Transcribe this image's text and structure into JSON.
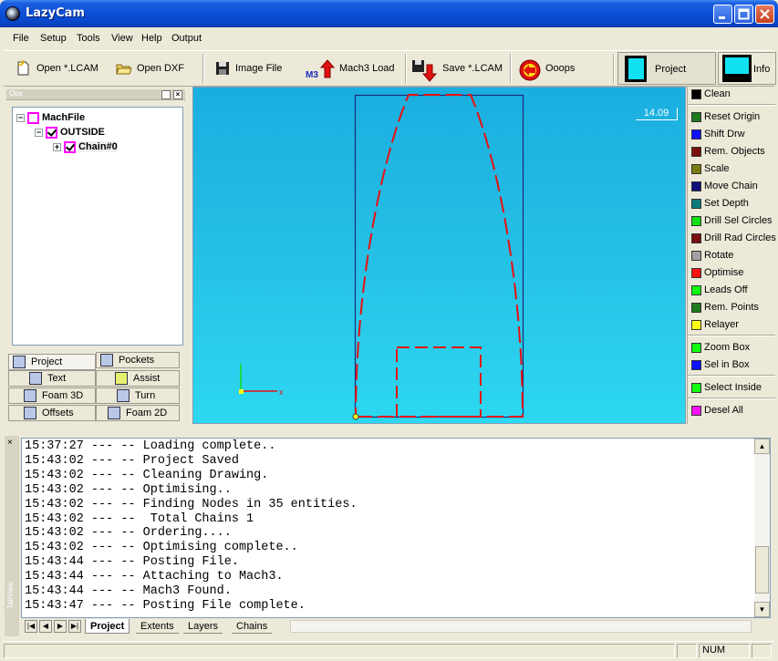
{
  "window": {
    "title": "LazyCam"
  },
  "menu": [
    "File",
    "Setup",
    "Tools",
    "View",
    "Help",
    "Output"
  ],
  "toolbar": {
    "open_lcam": "Open *.LCAM",
    "open_dxf": "Open DXF",
    "image_file": "Image File",
    "mach3_badge": "M3",
    "mach3_load": "Mach3 Load",
    "save_lcam": "Save *.LCAM",
    "ooops": "Ooops",
    "project": "Project",
    "info": "Info"
  },
  "ops": {
    "title": "Ops",
    "tree": {
      "root": "MachFile",
      "group": "OUTSIDE",
      "chain": "Chain#0"
    },
    "tabs": {
      "project": "Project",
      "pockets": "Pockets",
      "text": "Text",
      "assist": "Assist",
      "foam3d": "Foam 3D",
      "turn": "Turn",
      "offsets": "Offsets",
      "foam2d": "Foam 2D"
    }
  },
  "canvas": {
    "zoom": "14.09"
  },
  "commands": [
    {
      "label": "Clean",
      "color": "#000000"
    },
    {
      "label": "Reset Origin",
      "color": "#1e7b1e"
    },
    {
      "label": "Shift Drw",
      "color": "#1010ff"
    },
    {
      "label": "Rem. Objects",
      "color": "#7a1010"
    },
    {
      "label": "Scale",
      "color": "#7a7a10"
    },
    {
      "label": "Move Chain",
      "color": "#10107a"
    },
    {
      "label": "Set Depth",
      "color": "#107a7a"
    },
    {
      "label": "Drill Sel Circles",
      "color": "#10e010"
    },
    {
      "label": "Drill Rad Circles",
      "color": "#7a1010"
    },
    {
      "label": "Rotate",
      "color": "#a0a0a0"
    },
    {
      "label": "Optimise",
      "color": "#ff1010"
    },
    {
      "label": "Leads Off",
      "color": "#10ff10"
    },
    {
      "label": "Rem. Points",
      "color": "#1e7b1e"
    },
    {
      "label": "Relayer",
      "color": "#ffff10"
    },
    {
      "label": "Zoom Box",
      "color": "#10ff10"
    },
    {
      "label": "Sel in Box",
      "color": "#1010ff"
    },
    {
      "label": "Select Inside",
      "color": "#10ff10"
    },
    {
      "label": "Desel All",
      "color": "#ff10ff"
    }
  ],
  "log": {
    "side_label": "TabView",
    "lines": [
      "15:37:27 --- -- Loading complete..",
      "15:43:02 --- -- Project Saved",
      "15:43:02 --- -- Cleaning Drawing.",
      "15:43:02 --- -- Optimising..",
      "15:43:02 --- -- Finding Nodes in 35 entities.",
      "15:43:02 --- --  Total Chains 1",
      "15:43:02 --- -- Ordering....",
      "15:43:02 --- -- Optimising complete..",
      "15:43:44 --- -- Posting File.",
      "15:43:44 --- -- Attaching to Mach3.",
      "15:43:44 --- -- Mach3 Found.",
      "15:43:47 --- -- Posting File complete."
    ],
    "tabs": [
      "Project",
      "Extents",
      "Layers",
      "Chains"
    ]
  },
  "status": {
    "num": "NUM"
  }
}
